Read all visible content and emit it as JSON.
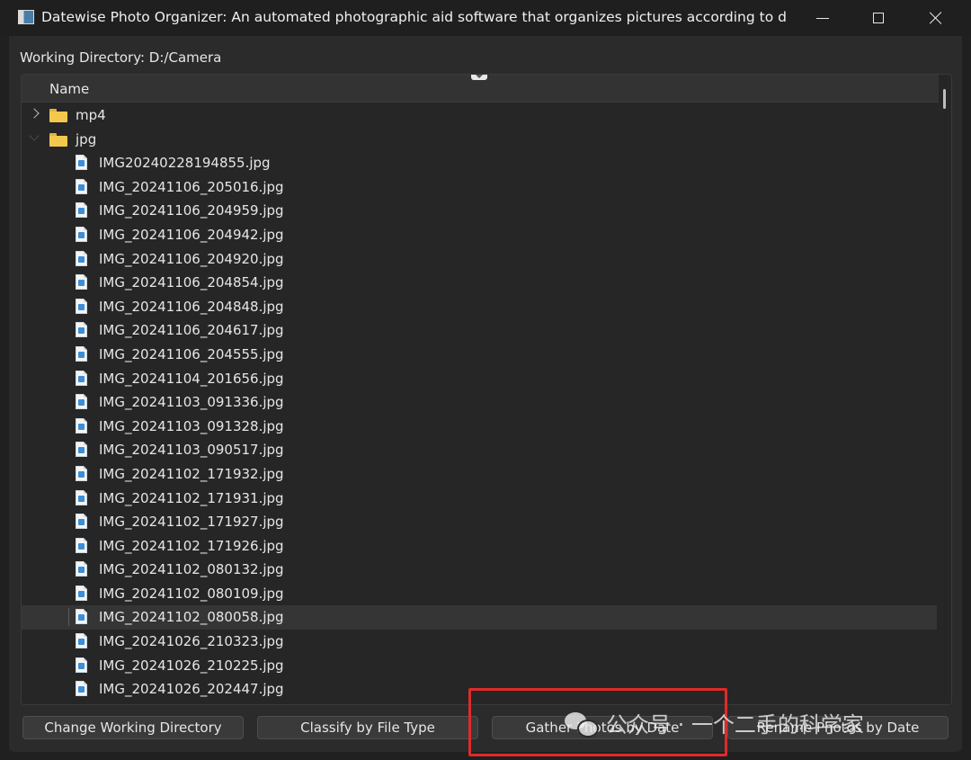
{
  "window": {
    "title": "Datewise Photo Organizer: An automated photographic aid software that organizes pictures according to date and ti..."
  },
  "workdir": {
    "label": "Working Directory: D:/Camera"
  },
  "tree": {
    "header": "Name",
    "folders": [
      {
        "name": "mp4",
        "expanded": false
      },
      {
        "name": "jpg",
        "expanded": true
      }
    ],
    "files": [
      "IMG20240228194855.jpg",
      "IMG_20241106_205016.jpg",
      "IMG_20241106_204959.jpg",
      "IMG_20241106_204942.jpg",
      "IMG_20241106_204920.jpg",
      "IMG_20241106_204854.jpg",
      "IMG_20241106_204848.jpg",
      "IMG_20241106_204617.jpg",
      "IMG_20241106_204555.jpg",
      "IMG_20241104_201656.jpg",
      "IMG_20241103_091336.jpg",
      "IMG_20241103_091328.jpg",
      "IMG_20241103_090517.jpg",
      "IMG_20241102_171932.jpg",
      "IMG_20241102_171931.jpg",
      "IMG_20241102_171927.jpg",
      "IMG_20241102_171926.jpg",
      "IMG_20241102_080132.jpg",
      "IMG_20241102_080109.jpg",
      "IMG_20241102_080058.jpg",
      "IMG_20241026_210323.jpg",
      "IMG_20241026_210225.jpg",
      "IMG_20241026_202447.jpg"
    ],
    "selected_file": "IMG_20241102_080058.jpg"
  },
  "buttons": {
    "change_dir": "Change Working Directory",
    "classify": "Classify by File Type",
    "gather": "Gather Photos by Date",
    "rename": "Rename Photos by Date"
  },
  "watermark": {
    "text": "公众号 · 一个二手的科学家"
  },
  "colors": {
    "annotation": "#e02a2a",
    "folder": "#f3c94d",
    "file_accent": "#3c8ed6"
  }
}
